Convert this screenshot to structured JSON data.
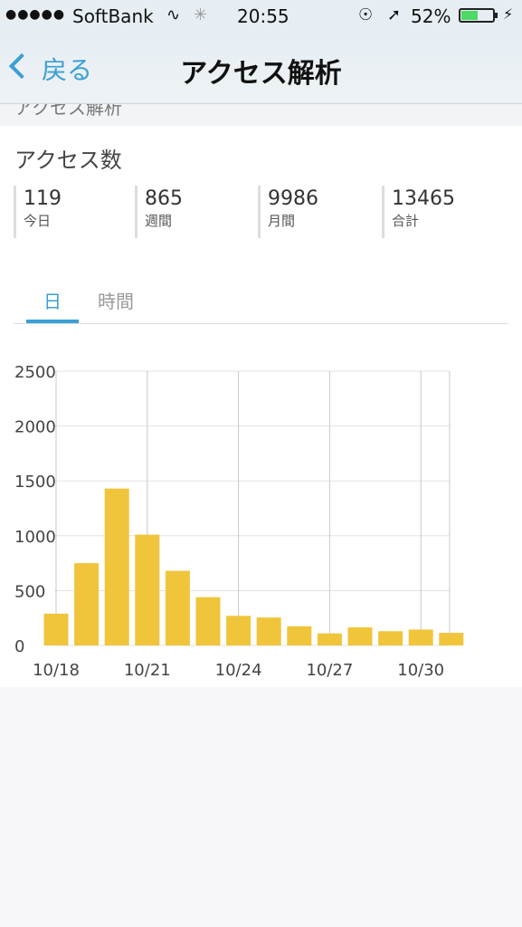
{
  "status_bar": {
    "signal": "●●●●●",
    "carrier": "SoftBank",
    "time": "20:55",
    "battery_pct": "52%",
    "battery_level": 0.52,
    "icons": [
      "wifi-icon",
      "activity-spinner-icon",
      "orientation-lock-icon",
      "location-arrow-icon",
      "battery-icon",
      "charging-bolt-icon"
    ]
  },
  "nav": {
    "back_label": "戻る",
    "title": "アクセス解析",
    "accent": "#3a9fd5"
  },
  "peek_text": "アクセス解析",
  "access": {
    "heading": "アクセス数",
    "stats": [
      {
        "value": "119",
        "label": "今日"
      },
      {
        "value": "865",
        "label": "週間"
      },
      {
        "value": "9986",
        "label": "月間"
      },
      {
        "value": "13465",
        "label": "合計"
      }
    ]
  },
  "tabs": [
    {
      "label": "日",
      "active": true
    },
    {
      "label": "時間",
      "active": false
    }
  ],
  "chart_data": {
    "type": "bar",
    "color": "#f0c53c",
    "x_tick_labels": [
      "10/18",
      "10/21",
      "10/24",
      "10/27",
      "10/30"
    ],
    "categories": [
      "10/18",
      "10/19",
      "10/20",
      "10/21",
      "10/22",
      "10/23",
      "10/24",
      "10/25",
      "10/26",
      "10/27",
      "10/28",
      "10/29",
      "10/30",
      "10/31"
    ],
    "values": [
      290,
      750,
      1430,
      1010,
      680,
      440,
      270,
      255,
      175,
      110,
      165,
      130,
      145,
      115
    ],
    "y_ticks": [
      0,
      500,
      1000,
      1500,
      2000,
      2500
    ],
    "ylim": [
      0,
      2500
    ],
    "grid": true
  }
}
